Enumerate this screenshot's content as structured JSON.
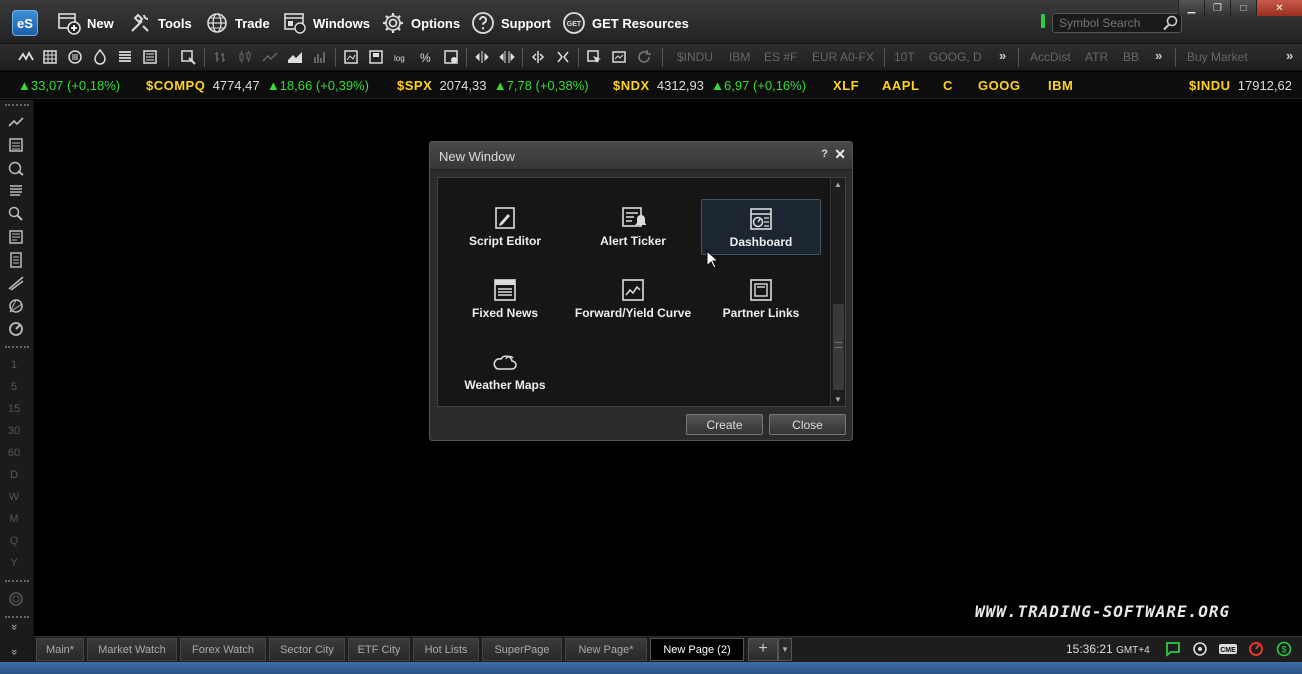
{
  "app": {
    "logo_text": "eS",
    "menu": [
      {
        "label": "New",
        "icon": "new-window-icon"
      },
      {
        "label": "Tools",
        "icon": "tools-icon"
      },
      {
        "label": "Trade",
        "icon": "globe-icon"
      },
      {
        "label": "Windows",
        "icon": "windows-icon"
      },
      {
        "label": "Options",
        "icon": "gear-icon"
      },
      {
        "label": "Support",
        "icon": "question-icon"
      },
      {
        "label": "GET Resources",
        "icon": "get-icon"
      }
    ],
    "get_badge": "GET",
    "symbol_search_placeholder": "Symbol Search"
  },
  "toolbar": {
    "symbols": [
      "$INDU",
      "IBM",
      "ES #F",
      "EUR A0-FX",
      "10T",
      "GOOG, D"
    ],
    "studies": [
      "AccDist",
      "ATR",
      "BB"
    ],
    "trade": "Buy Market",
    "more": "»"
  },
  "ticker": [
    {
      "sym": "",
      "val": "",
      "chg": "▲33,07 (+0,18%)"
    },
    {
      "sym": "$COMPQ",
      "val": "4774,47",
      "chg": "▲18,66 (+0,39%)"
    },
    {
      "sym": "$SPX",
      "val": "2074,33",
      "chg": "▲7,78 (+0,38%)"
    },
    {
      "sym": "$NDX",
      "val": "4312,93",
      "chg": "▲6,97 (+0,16%)"
    },
    {
      "sym": "XLF",
      "val": "",
      "chg": ""
    },
    {
      "sym": "AAPL",
      "val": "",
      "chg": ""
    },
    {
      "sym": "C",
      "val": "",
      "chg": ""
    },
    {
      "sym": "GOOG",
      "val": "",
      "chg": ""
    },
    {
      "sym": "IBM",
      "val": "",
      "chg": ""
    },
    {
      "sym": "$INDU",
      "val": "17912,62",
      "chg": ""
    }
  ],
  "sidebar": {
    "intervals": [
      "1",
      "5",
      "15",
      "30",
      "60",
      "D",
      "W",
      "M",
      "Q",
      "Y"
    ],
    "collapse": "»"
  },
  "dialog": {
    "title": "New Window",
    "help": "?",
    "close": "✕",
    "items": [
      {
        "label": "Script Editor",
        "icon": "script-editor-icon"
      },
      {
        "label": "Alert Ticker",
        "icon": "alert-ticker-icon"
      },
      {
        "label": "Dashboard",
        "icon": "dashboard-icon"
      },
      {
        "label": "Fixed News",
        "icon": "fixed-news-icon"
      },
      {
        "label": "Forward/Yield Curve",
        "icon": "yield-curve-icon"
      },
      {
        "label": "Partner Links",
        "icon": "partner-links-icon"
      },
      {
        "label": "Weather Maps",
        "icon": "weather-maps-icon"
      }
    ],
    "selected": "Dashboard",
    "create_label": "Create",
    "close_label": "Close"
  },
  "tabs": [
    {
      "label": "Main*",
      "active": false
    },
    {
      "label": "Market Watch",
      "active": false
    },
    {
      "label": "Forex Watch",
      "active": false
    },
    {
      "label": "Sector City",
      "active": false
    },
    {
      "label": "ETF City",
      "active": false
    },
    {
      "label": "Hot Lists",
      "active": false
    },
    {
      "label": "SuperPage",
      "active": false
    },
    {
      "label": "New Page*",
      "active": false
    },
    {
      "label": "New Page (2)",
      "active": true
    }
  ],
  "tab_add": "+",
  "status": {
    "clock": "15:36:21",
    "timezone": "GMT+4"
  },
  "watermark": "WWW.TRADING-SOFTWARE.ORG",
  "colors": {
    "ticker_symbol": "#ffd21e",
    "ticker_change_up": "#33dd33",
    "accent_blue": "#2b5587"
  }
}
